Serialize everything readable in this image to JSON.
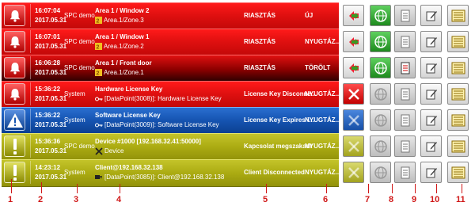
{
  "rows": [
    {
      "time": "16:07:04",
      "date": "2017.05.31",
      "source": "SPC demo",
      "loc1": "Area 1 / Window 2",
      "loc2": "Area.1/Zone.3",
      "status": "RIASZTÁS",
      "state": "ÚJ",
      "bg": "red",
      "icon": "bell-icon"
    },
    {
      "time": "16:07:01",
      "date": "2017.05.31",
      "source": "SPC demo",
      "loc1": "Area 1 / Window 1",
      "loc2": "Area.1/Zone.2",
      "status": "RIASZTÁS",
      "state": "NYUGTÁZ...",
      "bg": "red",
      "icon": "bell-icon"
    },
    {
      "time": "16:06:28",
      "date": "2017.05.31",
      "source": "SPC demo",
      "loc1": "Area 1 / Front door",
      "loc2": "Area.1/Zone.1",
      "status": "RIASZTÁS",
      "state": "TÖRÖLT",
      "bg": "dark",
      "icon": "bell-icon"
    },
    {
      "time": "15:36:22",
      "date": "2017.05.31",
      "source": "System",
      "loc1": "Hardware License Key",
      "loc2": "[DataPoint(3008)]: Hardware License Key",
      "status": "License Key Disconne...",
      "state": "NYUGTÁZ...",
      "bg": "red",
      "icon": "bell-icon"
    },
    {
      "time": "15:36:22",
      "date": "2017.05.31",
      "source": "System",
      "loc1": "Software License Key",
      "loc2": "[DataPoint(3009)]: Software License Key",
      "status": "License Key Expires i...",
      "state": "NYUGTÁZ...",
      "bg": "blue",
      "icon": "warning-icon"
    },
    {
      "time": "15:36:36",
      "date": "2017.05.31",
      "source": "SPC demo",
      "loc1": "Device #1000 [192.168.32.41:50000]",
      "loc2": "Device",
      "status": "Kapcsolat megszakadt",
      "state": "NYUGTÁZ...",
      "bg": "olive",
      "icon": "exclamation-icon"
    },
    {
      "time": "14:23:12",
      "date": "2017.05.31",
      "source": "System",
      "loc1": "Client@192.168.32.138",
      "loc2": "[DataPoint(3085)]: Client@192.168.32.138",
      "status": "Client Disconnected",
      "state": "NYUGTÁZ...",
      "bg": "olive",
      "icon": "exclamation-icon"
    }
  ],
  "column_numbers": [
    "1",
    "2",
    "3",
    "4",
    "5",
    "6",
    "7",
    "8",
    "9",
    "10",
    "11"
  ],
  "colors": {
    "red": "#e01010",
    "blue": "#1553b0",
    "olive": "#abab12",
    "marker": "#d01818"
  }
}
